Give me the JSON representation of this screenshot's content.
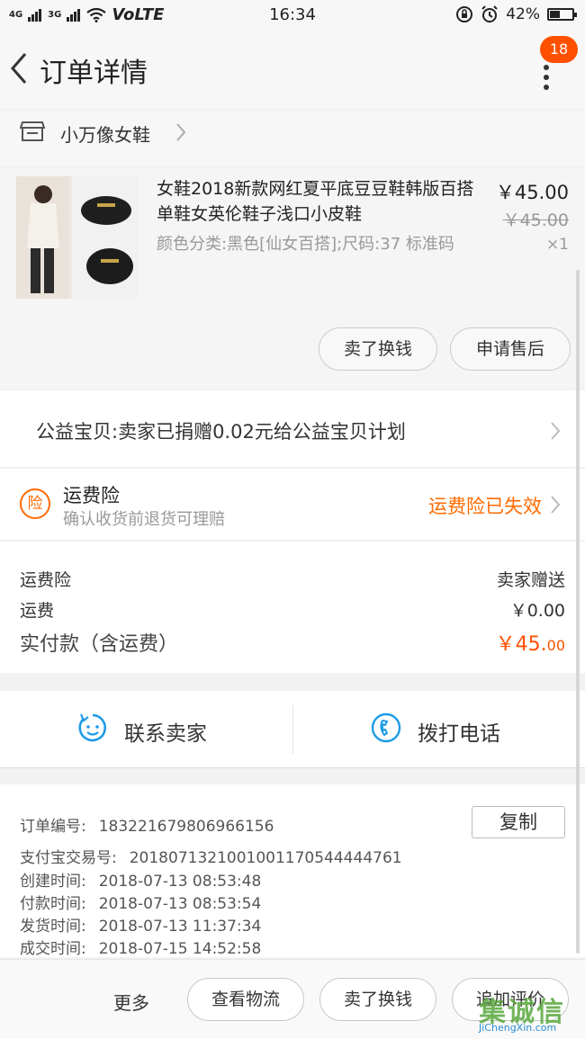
{
  "status_bar": {
    "signal_left": "4G",
    "signal_right": "3G",
    "network": "VoLTE",
    "time": "16:34",
    "battery": "42%"
  },
  "header": {
    "title": "订单详情",
    "badge_count": "18"
  },
  "store": {
    "name": "小万像女鞋"
  },
  "product": {
    "name": "女鞋2018新款网红夏平底豆豆鞋韩版百搭单鞋女英伦鞋子浅口小皮鞋",
    "sku": "颜色分类:黑色[仙女百搭];尺码:37  标准码",
    "price": "￥45.00",
    "original_price": "￥45.00",
    "quantity": "×1",
    "buttons": {
      "sell": "卖了换钱",
      "after_sale": "申请售后"
    }
  },
  "charity": {
    "text": "公益宝贝:卖家已捐赠0.02元给公益宝贝计划"
  },
  "insurance": {
    "icon_text": "险",
    "title": "运费险",
    "subtitle": "确认收货前退货可理赔",
    "status": "运费险已失效"
  },
  "fees": {
    "insurance_label": "运费险",
    "insurance_value": "卖家赠送",
    "shipping_label": "运费",
    "shipping_value": "￥0.00",
    "total_label": "实付款（含运费）",
    "total_value_main": "￥45.",
    "total_value_cents": "00"
  },
  "contact": {
    "seller": "联系卖家",
    "phone": "拨打电话"
  },
  "order_info": {
    "copy_label": "复制",
    "rows": [
      {
        "key": "订单编号:",
        "value": "183221679806966156"
      },
      {
        "key": "支付宝交易号:",
        "value": "2018071321001001170544444761"
      },
      {
        "key": "创建时间:",
        "value": "2018-07-13 08:53:48"
      },
      {
        "key": "付款时间:",
        "value": "2018-07-13 08:53:54"
      },
      {
        "key": "发货时间:",
        "value": "2018-07-13 11:37:34"
      },
      {
        "key": "成交时间:",
        "value": "2018-07-15 14:52:58"
      }
    ]
  },
  "bottom_bar": {
    "more": "更多",
    "logistics": "查看物流",
    "sell": "卖了换钱",
    "review": "追加评价"
  },
  "watermark": {
    "logo": "集诚信",
    "url": "JiChengXin.com"
  },
  "colors": {
    "accent": "#ff5000",
    "insurance": "#ff6a00",
    "contact_icon": "#1e9be8"
  }
}
